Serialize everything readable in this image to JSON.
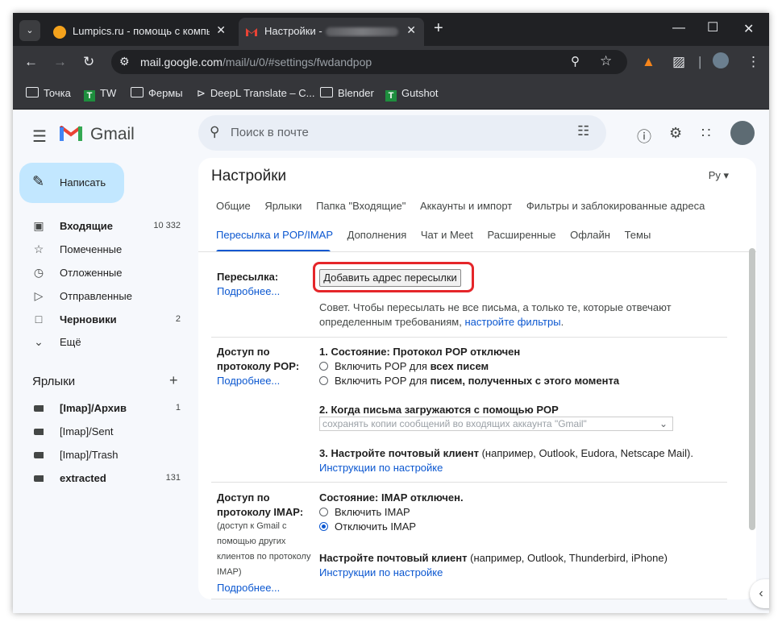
{
  "browser": {
    "tabs": [
      {
        "title": "Lumpics.ru - помощь с компь",
        "favicon_color": "#f4a21c"
      },
      {
        "title": "Настройки -",
        "favicon_color": "#ea4335"
      }
    ],
    "url_host": "mail.google.com",
    "url_path": "/mail/u/0/#settings/fwdandpop",
    "bookmarks": [
      "Точка",
      "TW",
      "Фермы",
      "DeepL Translate – C...",
      "Blender",
      "Gutshot"
    ]
  },
  "gmail": {
    "logo_text": "Gmail",
    "search_placeholder": "Поиск в почте",
    "compose_label": "Написать",
    "nav": [
      {
        "label": "Входящие",
        "count": "10 332",
        "icon": "inbox-icon"
      },
      {
        "label": "Помеченные",
        "count": "",
        "icon": "star-icon"
      },
      {
        "label": "Отложенные",
        "count": "",
        "icon": "clock-icon"
      },
      {
        "label": "Отправленные",
        "count": "",
        "icon": "send-icon"
      },
      {
        "label": "Черновики",
        "count": "2",
        "icon": "draft-icon"
      },
      {
        "label": "Ещё",
        "count": "",
        "icon": "chevron-down-icon"
      }
    ],
    "labels_title": "Ярлыки",
    "labels": [
      {
        "label": "[Imap]/Архив",
        "count": "1"
      },
      {
        "label": "[Imap]/Sent",
        "count": ""
      },
      {
        "label": "[Imap]/Trash",
        "count": ""
      },
      {
        "label": "extracted",
        "count": "131"
      }
    ]
  },
  "settings": {
    "title": "Настройки",
    "lang": "Ру",
    "tabs_row1": [
      "Общие",
      "Ярлыки",
      "Папка \"Входящие\"",
      "Аккаунты и импорт",
      "Фильтры и заблокированные адреса"
    ],
    "tabs_row2": [
      "Пересылка и POP/IMAP",
      "Дополнения",
      "Чат и Meet",
      "Расширенные",
      "Офлайн",
      "Темы"
    ],
    "forwarding": {
      "label": "Пересылка:",
      "more": "Подробнее...",
      "button": "Добавить адрес пересылки",
      "tip_1": "Совет. Чтобы пересылать не все письма, а только те, которые отвечают",
      "tip_2": "определенным требованиям, ",
      "tip_link": "настройте фильтры",
      "tip_end": "."
    },
    "pop": {
      "label_1": "Доступ по",
      "label_2": "протоколу POP:",
      "more": "Подробнее...",
      "status": "1. Состояние: Протокол POP отключен",
      "opt1_pre": "Включить POP для ",
      "opt1_bold": "всех писем",
      "opt2_pre": "Включить POP для ",
      "opt2_bold": "писем, полученных с этого момента",
      "when": "2. Когда письма загружаются с помощью POP",
      "select_value": "сохранять копии сообщений во входящих аккаунта \"Gmail\"",
      "client_bold": "3. Настройте почтовый клиент",
      "client_rest": " (например, Outlook, Eudora, Netscape Mail).",
      "instructions": "Инструкции по настройке"
    },
    "imap": {
      "label_1": "Доступ по",
      "label_2": "протоколу IMAP:",
      "note_1": "(доступ к Gmail с",
      "note_2": "помощью других",
      "note_3": "клиентов по протоколу",
      "note_4": "IMAP)",
      "more": "Подробнее...",
      "status": "Состояние: IMAP отключен.",
      "opt1": "Включить IMAP",
      "opt2": "Отключить IMAP",
      "client_bold": "Настройте почтовый клиент",
      "client_rest": " (например, Outlook, Thunderbird, iPhone)",
      "instructions": "Инструкции по настройке"
    }
  }
}
